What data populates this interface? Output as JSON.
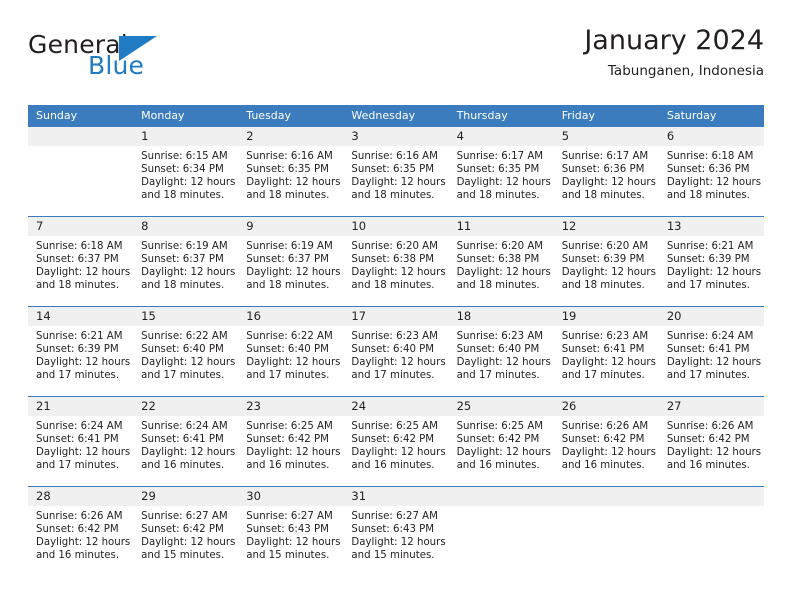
{
  "brand": {
    "name_part1": "General",
    "name_part2": "Blue",
    "logo_icon": "triangle-icon",
    "color_blue": "#1e7bc4",
    "color_dark": "#231f20"
  },
  "header": {
    "title": "January 2024",
    "subtitle": "Tabunganen, Indonesia"
  },
  "theme": {
    "header_row_bg": "#3a7cbe",
    "daynum_bg": "#f0f0f0",
    "separator": "#3a7cbe"
  },
  "calendar": {
    "weekdays": [
      "Sunday",
      "Monday",
      "Tuesday",
      "Wednesday",
      "Thursday",
      "Friday",
      "Saturday"
    ],
    "labels": {
      "sunrise": "Sunrise:",
      "sunset": "Sunset:",
      "daylight": "Daylight:"
    },
    "weeks": [
      [
        {
          "day": "",
          "sunrise": "",
          "sunset": "",
          "daylight_line1": "",
          "daylight_line2": ""
        },
        {
          "day": "1",
          "sunrise": "Sunrise: 6:15 AM",
          "sunset": "Sunset: 6:34 PM",
          "daylight_line1": "Daylight: 12 hours",
          "daylight_line2": "and 18 minutes."
        },
        {
          "day": "2",
          "sunrise": "Sunrise: 6:16 AM",
          "sunset": "Sunset: 6:35 PM",
          "daylight_line1": "Daylight: 12 hours",
          "daylight_line2": "and 18 minutes."
        },
        {
          "day": "3",
          "sunrise": "Sunrise: 6:16 AM",
          "sunset": "Sunset: 6:35 PM",
          "daylight_line1": "Daylight: 12 hours",
          "daylight_line2": "and 18 minutes."
        },
        {
          "day": "4",
          "sunrise": "Sunrise: 6:17 AM",
          "sunset": "Sunset: 6:35 PM",
          "daylight_line1": "Daylight: 12 hours",
          "daylight_line2": "and 18 minutes."
        },
        {
          "day": "5",
          "sunrise": "Sunrise: 6:17 AM",
          "sunset": "Sunset: 6:36 PM",
          "daylight_line1": "Daylight: 12 hours",
          "daylight_line2": "and 18 minutes."
        },
        {
          "day": "6",
          "sunrise": "Sunrise: 6:18 AM",
          "sunset": "Sunset: 6:36 PM",
          "daylight_line1": "Daylight: 12 hours",
          "daylight_line2": "and 18 minutes."
        }
      ],
      [
        {
          "day": "7",
          "sunrise": "Sunrise: 6:18 AM",
          "sunset": "Sunset: 6:37 PM",
          "daylight_line1": "Daylight: 12 hours",
          "daylight_line2": "and 18 minutes."
        },
        {
          "day": "8",
          "sunrise": "Sunrise: 6:19 AM",
          "sunset": "Sunset: 6:37 PM",
          "daylight_line1": "Daylight: 12 hours",
          "daylight_line2": "and 18 minutes."
        },
        {
          "day": "9",
          "sunrise": "Sunrise: 6:19 AM",
          "sunset": "Sunset: 6:37 PM",
          "daylight_line1": "Daylight: 12 hours",
          "daylight_line2": "and 18 minutes."
        },
        {
          "day": "10",
          "sunrise": "Sunrise: 6:20 AM",
          "sunset": "Sunset: 6:38 PM",
          "daylight_line1": "Daylight: 12 hours",
          "daylight_line2": "and 18 minutes."
        },
        {
          "day": "11",
          "sunrise": "Sunrise: 6:20 AM",
          "sunset": "Sunset: 6:38 PM",
          "daylight_line1": "Daylight: 12 hours",
          "daylight_line2": "and 18 minutes."
        },
        {
          "day": "12",
          "sunrise": "Sunrise: 6:20 AM",
          "sunset": "Sunset: 6:39 PM",
          "daylight_line1": "Daylight: 12 hours",
          "daylight_line2": "and 18 minutes."
        },
        {
          "day": "13",
          "sunrise": "Sunrise: 6:21 AM",
          "sunset": "Sunset: 6:39 PM",
          "daylight_line1": "Daylight: 12 hours",
          "daylight_line2": "and 17 minutes."
        }
      ],
      [
        {
          "day": "14",
          "sunrise": "Sunrise: 6:21 AM",
          "sunset": "Sunset: 6:39 PM",
          "daylight_line1": "Daylight: 12 hours",
          "daylight_line2": "and 17 minutes."
        },
        {
          "day": "15",
          "sunrise": "Sunrise: 6:22 AM",
          "sunset": "Sunset: 6:40 PM",
          "daylight_line1": "Daylight: 12 hours",
          "daylight_line2": "and 17 minutes."
        },
        {
          "day": "16",
          "sunrise": "Sunrise: 6:22 AM",
          "sunset": "Sunset: 6:40 PM",
          "daylight_line1": "Daylight: 12 hours",
          "daylight_line2": "and 17 minutes."
        },
        {
          "day": "17",
          "sunrise": "Sunrise: 6:23 AM",
          "sunset": "Sunset: 6:40 PM",
          "daylight_line1": "Daylight: 12 hours",
          "daylight_line2": "and 17 minutes."
        },
        {
          "day": "18",
          "sunrise": "Sunrise: 6:23 AM",
          "sunset": "Sunset: 6:40 PM",
          "daylight_line1": "Daylight: 12 hours",
          "daylight_line2": "and 17 minutes."
        },
        {
          "day": "19",
          "sunrise": "Sunrise: 6:23 AM",
          "sunset": "Sunset: 6:41 PM",
          "daylight_line1": "Daylight: 12 hours",
          "daylight_line2": "and 17 minutes."
        },
        {
          "day": "20",
          "sunrise": "Sunrise: 6:24 AM",
          "sunset": "Sunset: 6:41 PM",
          "daylight_line1": "Daylight: 12 hours",
          "daylight_line2": "and 17 minutes."
        }
      ],
      [
        {
          "day": "21",
          "sunrise": "Sunrise: 6:24 AM",
          "sunset": "Sunset: 6:41 PM",
          "daylight_line1": "Daylight: 12 hours",
          "daylight_line2": "and 17 minutes."
        },
        {
          "day": "22",
          "sunrise": "Sunrise: 6:24 AM",
          "sunset": "Sunset: 6:41 PM",
          "daylight_line1": "Daylight: 12 hours",
          "daylight_line2": "and 16 minutes."
        },
        {
          "day": "23",
          "sunrise": "Sunrise: 6:25 AM",
          "sunset": "Sunset: 6:42 PM",
          "daylight_line1": "Daylight: 12 hours",
          "daylight_line2": "and 16 minutes."
        },
        {
          "day": "24",
          "sunrise": "Sunrise: 6:25 AM",
          "sunset": "Sunset: 6:42 PM",
          "daylight_line1": "Daylight: 12 hours",
          "daylight_line2": "and 16 minutes."
        },
        {
          "day": "25",
          "sunrise": "Sunrise: 6:25 AM",
          "sunset": "Sunset: 6:42 PM",
          "daylight_line1": "Daylight: 12 hours",
          "daylight_line2": "and 16 minutes."
        },
        {
          "day": "26",
          "sunrise": "Sunrise: 6:26 AM",
          "sunset": "Sunset: 6:42 PM",
          "daylight_line1": "Daylight: 12 hours",
          "daylight_line2": "and 16 minutes."
        },
        {
          "day": "27",
          "sunrise": "Sunrise: 6:26 AM",
          "sunset": "Sunset: 6:42 PM",
          "daylight_line1": "Daylight: 12 hours",
          "daylight_line2": "and 16 minutes."
        }
      ],
      [
        {
          "day": "28",
          "sunrise": "Sunrise: 6:26 AM",
          "sunset": "Sunset: 6:42 PM",
          "daylight_line1": "Daylight: 12 hours",
          "daylight_line2": "and 16 minutes."
        },
        {
          "day": "29",
          "sunrise": "Sunrise: 6:27 AM",
          "sunset": "Sunset: 6:42 PM",
          "daylight_line1": "Daylight: 12 hours",
          "daylight_line2": "and 15 minutes."
        },
        {
          "day": "30",
          "sunrise": "Sunrise: 6:27 AM",
          "sunset": "Sunset: 6:43 PM",
          "daylight_line1": "Daylight: 12 hours",
          "daylight_line2": "and 15 minutes."
        },
        {
          "day": "31",
          "sunrise": "Sunrise: 6:27 AM",
          "sunset": "Sunset: 6:43 PM",
          "daylight_line1": "Daylight: 12 hours",
          "daylight_line2": "and 15 minutes."
        },
        {
          "day": "",
          "sunrise": "",
          "sunset": "",
          "daylight_line1": "",
          "daylight_line2": ""
        },
        {
          "day": "",
          "sunrise": "",
          "sunset": "",
          "daylight_line1": "",
          "daylight_line2": ""
        },
        {
          "day": "",
          "sunrise": "",
          "sunset": "",
          "daylight_line1": "",
          "daylight_line2": ""
        }
      ]
    ]
  }
}
